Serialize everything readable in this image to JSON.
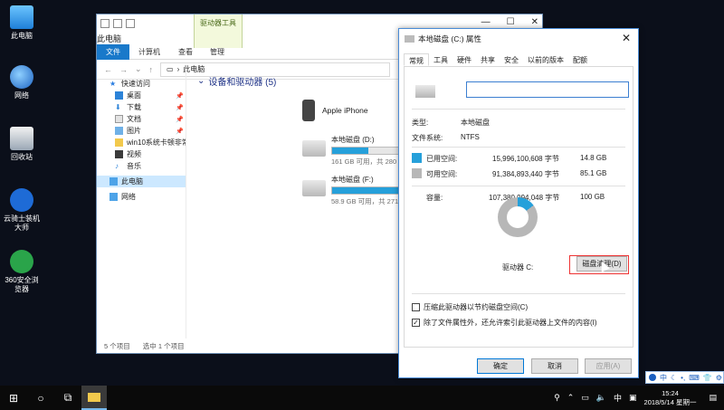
{
  "desktop": {
    "icons": [
      {
        "label": "此电脑"
      },
      {
        "label": "网络"
      },
      {
        "label": "回收站"
      },
      {
        "label": "云骑士装机大师"
      },
      {
        "label": "360安全浏览器"
      }
    ]
  },
  "explorer": {
    "title": "此电脑",
    "tool_tab": "驱动器工具",
    "ribbon": {
      "file": "文件",
      "computer": "计算机",
      "view": "查看",
      "manage": "管理"
    },
    "address": "此电脑",
    "nav": [
      {
        "label": "快速访问"
      },
      {
        "label": "桌面"
      },
      {
        "label": "下载"
      },
      {
        "label": "文档"
      },
      {
        "label": "图片"
      },
      {
        "label": "win10系统卡顿非常"
      },
      {
        "label": "视频"
      },
      {
        "label": "音乐"
      },
      {
        "label": "此电脑"
      },
      {
        "label": "网络"
      }
    ],
    "section": "设备和驱动器 (5)",
    "phone": "Apple iPhone",
    "drives": [
      {
        "name": "本地磁盘 (D:)",
        "free": "161 GB 可用，共 280 GB",
        "used_fraction": 0.425
      },
      {
        "name": "本地磁盘 (F:)",
        "free": "58.9 GB 可用，共 271 GB",
        "used_fraction": 0.78
      }
    ],
    "status": {
      "count": "5 个项目",
      "selected": "选中 1 个项目"
    }
  },
  "props": {
    "title": "本地磁盘 (C:) 属性",
    "tabs": [
      "常规",
      "工具",
      "硬件",
      "共享",
      "安全",
      "以前的版本",
      "配额"
    ],
    "name_value": "",
    "type_label": "类型:",
    "type_value": "本地磁盘",
    "fs_label": "文件系统:",
    "fs_value": "NTFS",
    "used_label": "已用空间:",
    "used_bytes": "15,996,100,608 字节",
    "used_gb": "14.8 GB",
    "free_label": "可用空间:",
    "free_bytes": "91,384,893,440 字节",
    "free_gb": "85.1 GB",
    "cap_label": "容量:",
    "cap_bytes": "107,380,994,048 字节",
    "cap_gb": "100 GB",
    "drive_label": "驱动器 C:",
    "cleanup": "磁盘清理(D)",
    "compress": "压缩此驱动器以节约磁盘空间(C)",
    "index": "除了文件属性外，还允许索引此驱动器上文件的内容(I)",
    "ok": "确定",
    "cancel": "取消",
    "apply": "应用(A)",
    "colors": {
      "used": "#26a0da",
      "free": "#b7b7b7"
    }
  },
  "taskbar": {
    "ime": "中",
    "time": "15:24",
    "date": "2018/5/14 星期一"
  }
}
